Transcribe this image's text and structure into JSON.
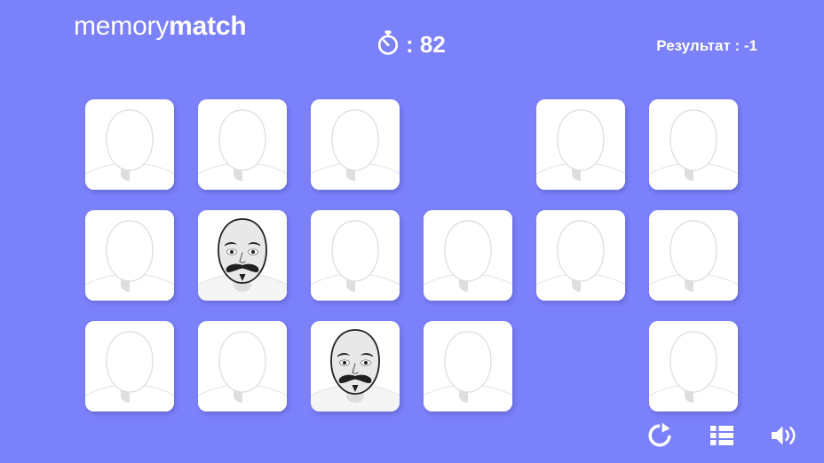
{
  "app": {
    "background_color": "#7b80fb",
    "card_color": "#ffffff",
    "text_color": "#ffffff"
  },
  "header": {
    "title_light": "memory",
    "title_bold": "match",
    "timer": {
      "icon": "stopwatch-icon",
      "value": ": 82",
      "seconds": 82
    },
    "score": {
      "label": "Результат : -1",
      "value": -1
    }
  },
  "board": {
    "rows": 3,
    "columns": 6,
    "cards": [
      {
        "row": 1,
        "col": 1,
        "state": "face-down",
        "present": true
      },
      {
        "row": 1,
        "col": 2,
        "state": "face-down",
        "present": true
      },
      {
        "row": 1,
        "col": 3,
        "state": "face-down",
        "present": true
      },
      {
        "row": 1,
        "col": 4,
        "state": "matched-removed",
        "present": false
      },
      {
        "row": 1,
        "col": 5,
        "state": "face-down",
        "present": true
      },
      {
        "row": 1,
        "col": 6,
        "state": "face-down",
        "present": true
      },
      {
        "row": 2,
        "col": 1,
        "state": "face-down",
        "present": true
      },
      {
        "row": 2,
        "col": 2,
        "state": "revealed",
        "present": true
      },
      {
        "row": 2,
        "col": 3,
        "state": "face-down",
        "present": true
      },
      {
        "row": 2,
        "col": 4,
        "state": "face-down",
        "present": true
      },
      {
        "row": 2,
        "col": 5,
        "state": "face-down",
        "present": true
      },
      {
        "row": 2,
        "col": 6,
        "state": "face-down",
        "present": true
      },
      {
        "row": 3,
        "col": 1,
        "state": "face-down",
        "present": true
      },
      {
        "row": 3,
        "col": 2,
        "state": "face-down",
        "present": true
      },
      {
        "row": 3,
        "col": 3,
        "state": "revealed",
        "present": true
      },
      {
        "row": 3,
        "col": 4,
        "state": "face-down",
        "present": true
      },
      {
        "row": 3,
        "col": 5,
        "state": "matched-removed",
        "present": false
      },
      {
        "row": 3,
        "col": 6,
        "state": "face-down",
        "present": true
      }
    ],
    "revealed_face": "bald-man-with-handlebar-mustache-and-soul-patch"
  },
  "toolbar": {
    "buttons": [
      {
        "icon": "restart-icon",
        "label": "Restart"
      },
      {
        "icon": "list-icon",
        "label": "List"
      },
      {
        "icon": "volume-icon",
        "label": "Sound"
      }
    ]
  }
}
